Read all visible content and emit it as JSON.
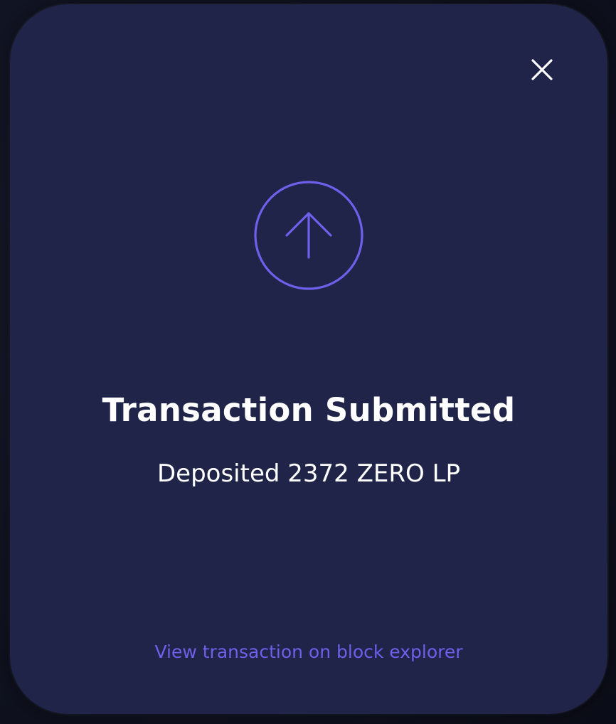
{
  "modal": {
    "title": "Transaction Submitted",
    "message": "Deposited 2372 ZERO LP",
    "link_label": "View transaction on block explorer",
    "close_icon": "close-icon",
    "status_icon": "arrow-up-circle-icon"
  },
  "colors": {
    "modal_background": "#1f2448",
    "accent": "#6f5fea",
    "text": "#ffffff"
  }
}
